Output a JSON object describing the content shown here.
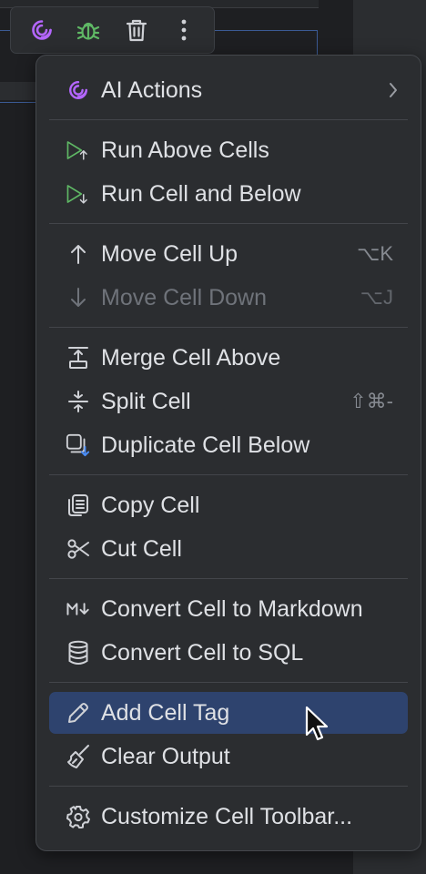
{
  "toolbar": {
    "buttons": [
      {
        "icon": "ai-assistant-icon"
      },
      {
        "icon": "debug-bug-icon"
      },
      {
        "icon": "trash-icon"
      },
      {
        "icon": "more-vertical-icon"
      }
    ]
  },
  "menu": {
    "ai_actions": {
      "label": "AI Actions",
      "icon": "ai-assistant-icon",
      "submenu": true
    },
    "run_above": {
      "label": "Run Above Cells",
      "icon": "run-above-icon"
    },
    "run_below": {
      "label": "Run Cell and Below",
      "icon": "run-below-icon"
    },
    "move_up": {
      "label": "Move Cell Up",
      "shortcut": "⌥K",
      "icon": "arrow-up-icon"
    },
    "move_down": {
      "label": "Move Cell Down",
      "shortcut": "⌥J",
      "icon": "arrow-down-icon",
      "disabled": true
    },
    "merge_above": {
      "label": "Merge Cell Above",
      "icon": "merge-above-icon"
    },
    "split": {
      "label": "Split Cell",
      "shortcut": "⇧⌘-",
      "icon": "split-icon"
    },
    "duplicate": {
      "label": "Duplicate Cell Below",
      "icon": "duplicate-icon"
    },
    "copy": {
      "label": "Copy Cell",
      "icon": "copy-icon"
    },
    "cut": {
      "label": "Cut Cell",
      "icon": "scissors-icon"
    },
    "to_markdown": {
      "label": "Convert Cell to Markdown",
      "icon": "markdown-icon"
    },
    "to_sql": {
      "label": "Convert Cell to SQL",
      "icon": "database-icon"
    },
    "add_tag": {
      "label": "Add Cell Tag",
      "icon": "pencil-icon",
      "selected": true
    },
    "clear_output": {
      "label": "Clear Output",
      "icon": "broom-icon"
    },
    "customize": {
      "label": "Customize Cell Toolbar...",
      "icon": "gear-icon"
    }
  },
  "colors": {
    "background": "#1e1f22",
    "menu": "#2b2d30",
    "selection": "#2e436e",
    "ai_accent": "#b466ff",
    "run_green": "#5fb865"
  }
}
